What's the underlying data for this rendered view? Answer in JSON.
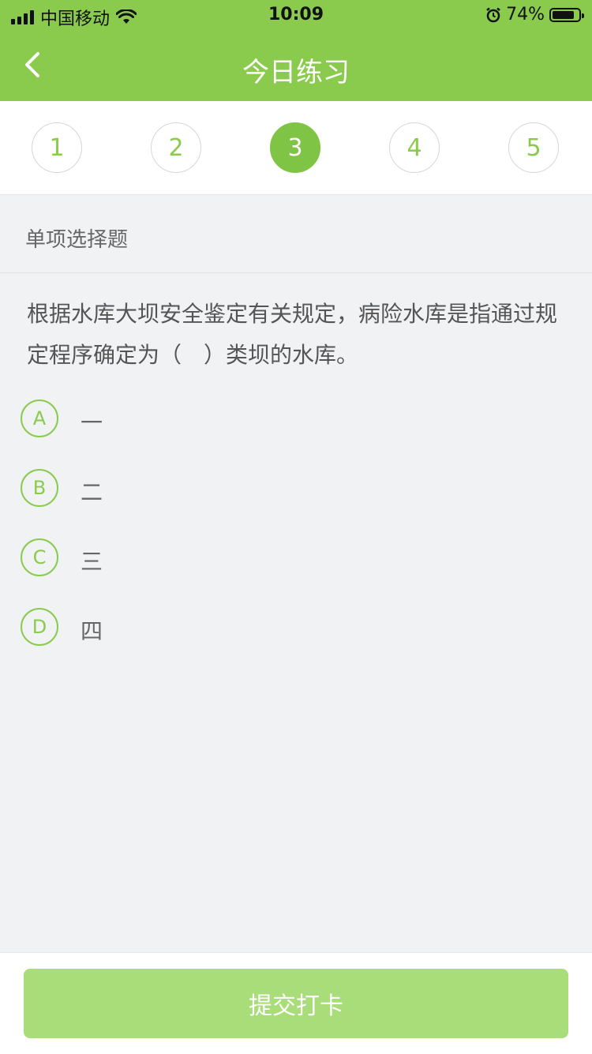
{
  "status_bar": {
    "carrier": "中国移动",
    "time": "10:09",
    "battery": "74%",
    "icons": [
      "signal-icon",
      "wifi-icon",
      "alarm-icon",
      "battery-icon"
    ]
  },
  "header": {
    "title": "今日练习",
    "back_icon": "chevron-left-icon"
  },
  "steps": [
    "1",
    "2",
    "3",
    "4",
    "5"
  ],
  "active_step": 3,
  "question": {
    "type_label": "单项选择题",
    "text": "根据水库大坝安全鉴定有关规定，病险水库是指通过规定程序确定为（　）类坝的水库。",
    "options": [
      {
        "key": "A",
        "text": "一"
      },
      {
        "key": "B",
        "text": "二"
      },
      {
        "key": "C",
        "text": "三"
      },
      {
        "key": "D",
        "text": "四"
      }
    ]
  },
  "footer": {
    "submit_label": "提交打卡"
  },
  "colors": {
    "brand_green": "#8acb4d",
    "active_step": "#7fc444",
    "submit_disabled": "#a8dd7a",
    "background": "#f0f2f4"
  }
}
